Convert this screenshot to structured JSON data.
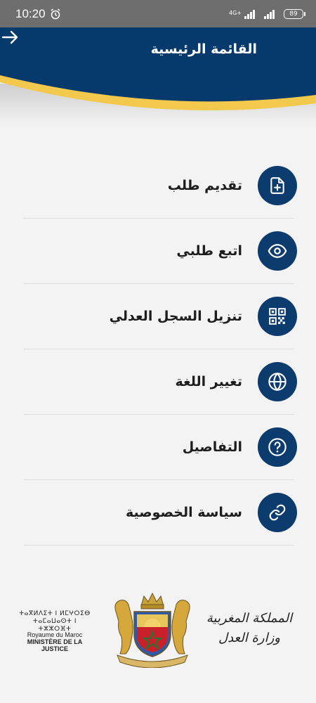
{
  "status_bar": {
    "time": "10:20",
    "network": "4G+",
    "battery": "89"
  },
  "header": {
    "title": "القائمة الرئيسية"
  },
  "menu": {
    "items": [
      {
        "label": "تقديم طلب",
        "icon": "file-plus-icon"
      },
      {
        "label": "اتبع طلبي",
        "icon": "eye-icon"
      },
      {
        "label": "تنزيل السجل العدلي",
        "icon": "qr-code-icon"
      },
      {
        "label": "تغيير اللغة",
        "icon": "globe-icon"
      },
      {
        "label": "التفاصيل",
        "icon": "question-icon"
      },
      {
        "label": "سياسة الخصوصية",
        "icon": "link-icon"
      }
    ]
  },
  "footer": {
    "tifinagh_line1": "ⵜⴰⴳⵍⴷⵉⵜ ⵏ ⵍⵎⵖⵔⵉⴱ",
    "tifinagh_line2": "ⵜⴰⵎⴰⵡⴰⵙⵜ ⵏ ⵜⵣⵣⵔⴼⵜ",
    "fr_line1": "Royaume du Maroc",
    "fr_line2": "MINISTÈRE DE LA JUSTICE",
    "ar_line1": "المملكة المغربية",
    "ar_line2": "وزارة العدل"
  },
  "colors": {
    "header_blue": "#063a6c",
    "accent_gold": "#f2c94c",
    "icon_circle": "#0c3b6e"
  }
}
